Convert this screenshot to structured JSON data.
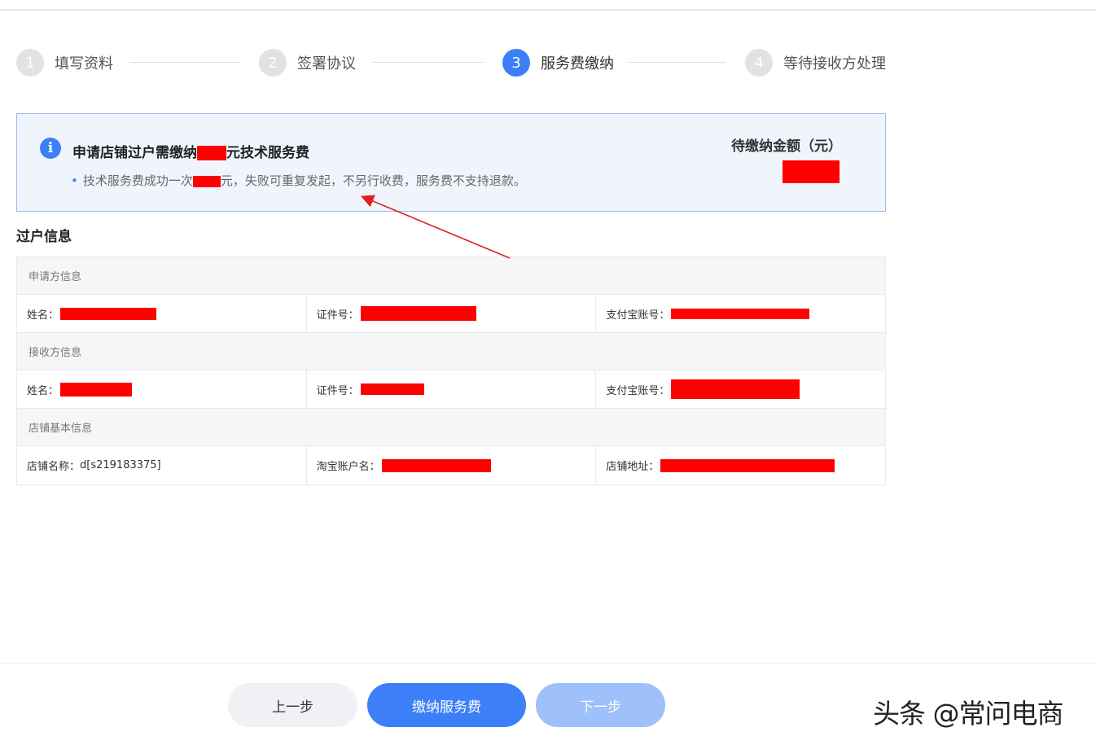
{
  "steps": [
    {
      "num": "1",
      "label": "填写资料"
    },
    {
      "num": "2",
      "label": "签署协议"
    },
    {
      "num": "3",
      "label": "服务费缴纳"
    },
    {
      "num": "4",
      "label": "等待接收方处理"
    }
  ],
  "active_step": 3,
  "notice": {
    "icon": "info-icon",
    "icon_glyph": "i",
    "title_prefix": "申请店铺过户需缴纳",
    "title_suffix": "元技术服务费",
    "sub_prefix": "技术服务费成功一次",
    "sub_suffix": "元，失败可重复发起，不另行收费，服务费不支持退款。",
    "pending_label": "待缴纳金额（元）"
  },
  "section_title": "过户信息",
  "table": {
    "applicant_header": "申请方信息",
    "applicant": {
      "name_label": "姓名：",
      "id_label": "证件号：",
      "alipay_label": "支付宝账号："
    },
    "receiver_header": "接收方信息",
    "receiver": {
      "name_label": "姓名：",
      "id_label": "证件号：",
      "alipay_label": "支付宝账号："
    },
    "shop_header": "店铺基本信息",
    "shop": {
      "name_label": "店铺名称：",
      "name_value": "d[s219183375]",
      "taobao_label": "淘宝账户名：",
      "address_label": "店铺地址："
    }
  },
  "buttons": {
    "prev": "上一步",
    "pay": "缴纳服务费",
    "next": "下一步"
  },
  "watermark": "头条 @常问电商",
  "colors": {
    "primary": "#3d7ff7",
    "redaction": "#ff0000",
    "annotation_arrow": "#e02020"
  }
}
